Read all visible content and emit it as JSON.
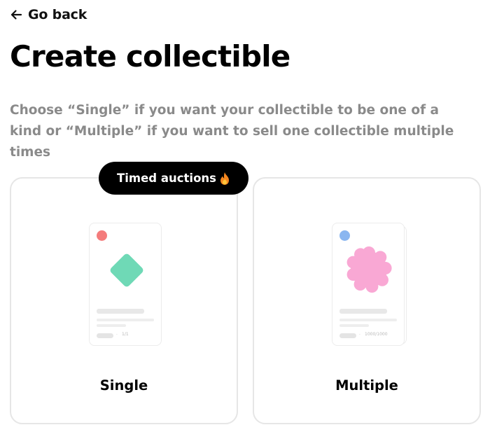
{
  "nav": {
    "back_label": "Go back",
    "back_icon": "arrow-left-icon"
  },
  "header": {
    "title": "Create collectible",
    "description": "Choose “Single” if you want your collectible to be one of a kind or “Multiple” if you want to sell one collectible multiple times"
  },
  "badge": {
    "label": "Timed auctions",
    "icon": "fire-icon"
  },
  "options": [
    {
      "label": "Single",
      "edition": "1/1",
      "dot_color": "#f47c7c",
      "art_color": "#6fd9b6",
      "art_shape": "diamond"
    },
    {
      "label": "Multiple",
      "edition": "1000/1000",
      "dot_color": "#8ab6f0",
      "art_color": "#f9a8d4",
      "art_shape": "flower"
    }
  ],
  "colors": {
    "text": "#000000",
    "muted": "#8a8a8a",
    "border": "#e6e6e6",
    "badge_bg": "#000000"
  }
}
